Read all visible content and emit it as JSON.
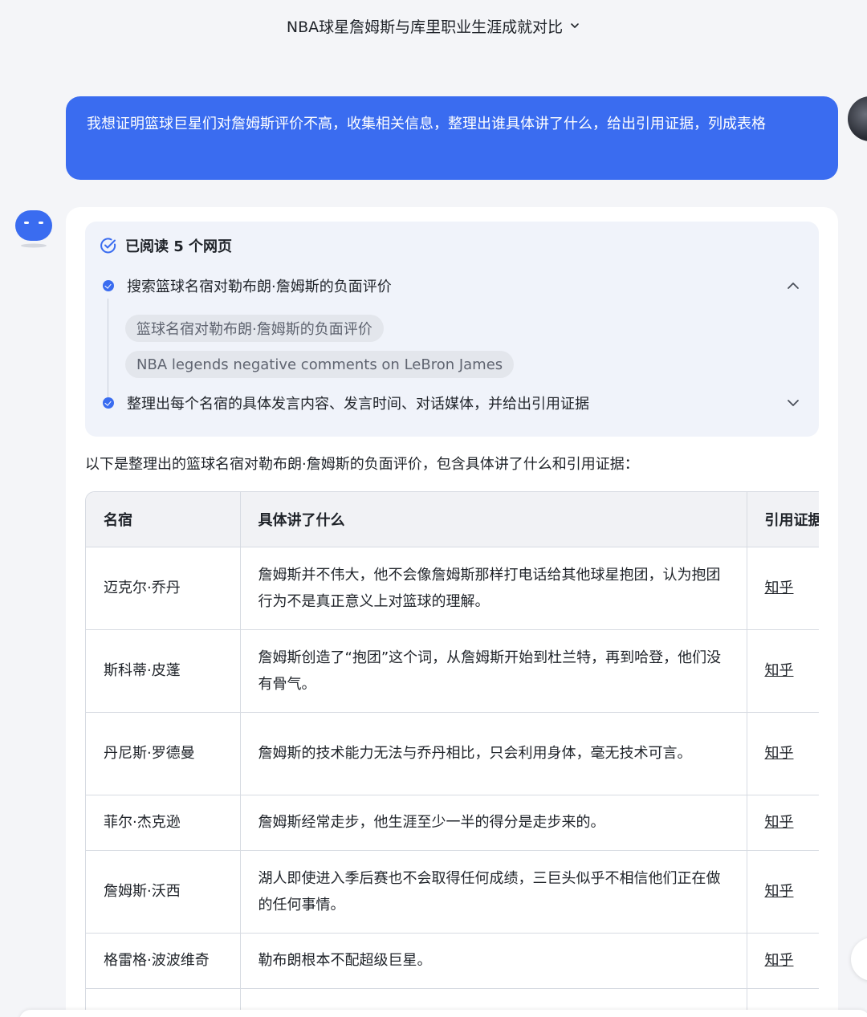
{
  "header": {
    "title": "NBA球星詹姆斯与库里职业生涯成就对比"
  },
  "user_message": {
    "text": "我想证明篮球巨星们对詹姆斯评价不高，收集相关信息，整理出谁具体讲了什么，给出引用证据，列成表格"
  },
  "reading": {
    "title": "已阅读 5 个网页",
    "step1": "搜索篮球名宿对勒布朗·詹姆斯的负面评价",
    "queries": [
      "篮球名宿对勒布朗·詹姆斯的负面评价",
      "NBA legends negative comments on LeBron James"
    ],
    "step2": "整理出每个名宿的具体发言内容、发言时间、对话媒体，并给出引用证据"
  },
  "intro": "以下是整理出的篮球名宿对勒布朗·詹姆斯的负面评价，包含具体讲了什么和引用证据：",
  "table": {
    "headers": [
      "名宿",
      "具体讲了什么",
      "引用证据"
    ],
    "rows": [
      {
        "name": "迈克尔·乔丹",
        "quote": "詹姆斯并不伟大，他不会像詹姆斯那样打电话给其他球星抱团，认为抱团行为不是真正意义上对篮球的理解。",
        "source": "知乎"
      },
      {
        "name": "斯科蒂·皮蓬",
        "quote": "詹姆斯创造了“抱团”这个词，从詹姆斯开始到杜兰特，再到哈登，他们没有骨气。",
        "source": "知乎"
      },
      {
        "name": "丹尼斯·罗德曼",
        "quote": "詹姆斯的技术能力无法与乔丹相比，只会利用身体，毫无技术可言。",
        "source": "知乎"
      },
      {
        "name": "菲尔·杰克逊",
        "quote": "詹姆斯经常走步，他生涯至少一半的得分是走步来的。",
        "source": "知乎"
      },
      {
        "name": "詹姆斯·沃西",
        "quote": "湖人即使进入季后赛也不会取得任何成绩，三巨头似乎不相信他们正在做的任何事情。",
        "source": "知乎"
      },
      {
        "name": "格雷格·波波维奇",
        "quote": "勒布朗根本不配超级巨星。",
        "source": "知乎"
      }
    ]
  },
  "colors": {
    "accent": "#3a6cf0",
    "panel": "#f0f3fa"
  },
  "icons": {
    "header_chevron": "chevron-down-icon",
    "read_status": "check-circle-icon",
    "collapse": "chevron-up-icon",
    "expand": "chevron-down-icon"
  }
}
